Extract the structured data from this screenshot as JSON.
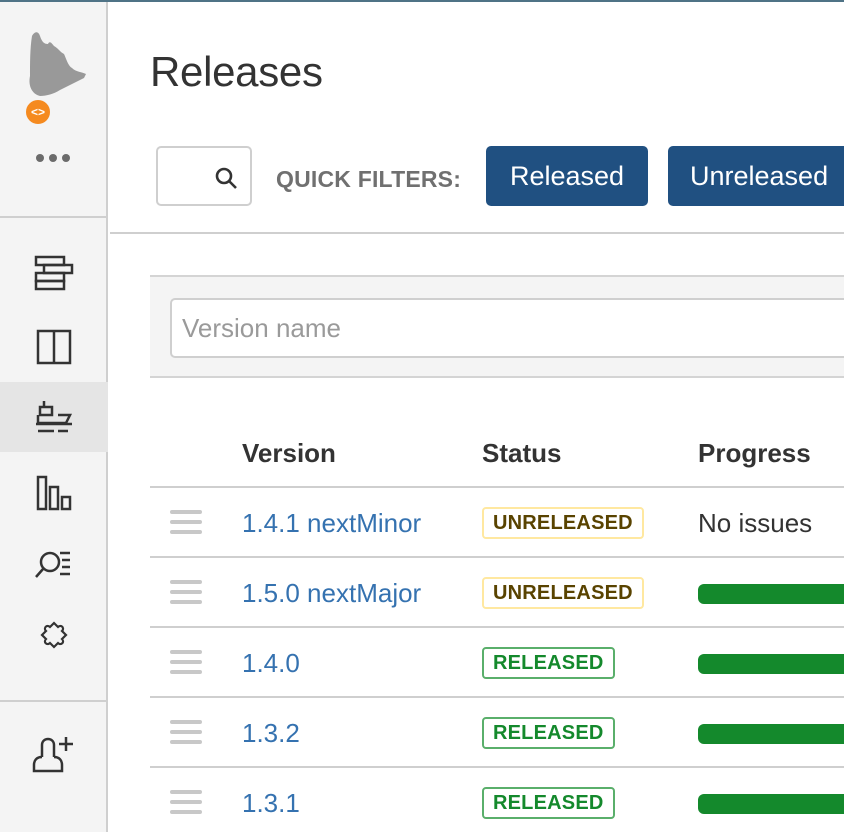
{
  "app": {
    "accent_color": "#205081",
    "logo_badge_glyph": "<>"
  },
  "sidebar": {
    "more_label": "More",
    "items": [
      {
        "name": "backlog",
        "icon": "backlog-icon",
        "active": false
      },
      {
        "name": "board",
        "icon": "board-icon",
        "active": false
      },
      {
        "name": "releases",
        "icon": "ship-icon",
        "active": true
      },
      {
        "name": "reports",
        "icon": "bar-chart-icon",
        "active": false
      },
      {
        "name": "issues",
        "icon": "search-list-icon",
        "active": false
      },
      {
        "name": "add-ons",
        "icon": "puzzle-icon",
        "active": false
      },
      {
        "name": "invite-people",
        "icon": "add-user-icon",
        "active": false
      }
    ]
  },
  "header": {
    "title": "Releases",
    "search": {
      "value": "",
      "placeholder": ""
    },
    "quick_filters_label": "QUICK FILTERS:",
    "quick_filters": [
      {
        "label": "Released"
      },
      {
        "label": "Unreleased"
      }
    ]
  },
  "filter": {
    "version_input": {
      "value": "",
      "placeholder": "Version name"
    }
  },
  "table": {
    "columns": [
      "Version",
      "Status",
      "Progress"
    ],
    "rows": [
      {
        "version": "1.4.1 nextMinor",
        "status": "UNRELEASED",
        "status_type": "unreleased",
        "progress_text": "No issues",
        "progress_complete": null
      },
      {
        "version": "1.5.0 nextMajor",
        "status": "UNRELEASED",
        "status_type": "unreleased",
        "progress_text": null,
        "progress_complete": 1.0
      },
      {
        "version": "1.4.0",
        "status": "RELEASED",
        "status_type": "released",
        "progress_text": null,
        "progress_complete": 1.0
      },
      {
        "version": "1.3.2",
        "status": "RELEASED",
        "status_type": "released",
        "progress_text": null,
        "progress_complete": 1.0
      },
      {
        "version": "1.3.1",
        "status": "RELEASED",
        "status_type": "released",
        "progress_text": null,
        "progress_complete": 1.0
      }
    ]
  },
  "colors": {
    "released": "#14892c",
    "unreleased_text": "#594300",
    "unreleased_border": "#ffe8a0",
    "link": "#3572b0",
    "progress_done": "#14892c"
  }
}
